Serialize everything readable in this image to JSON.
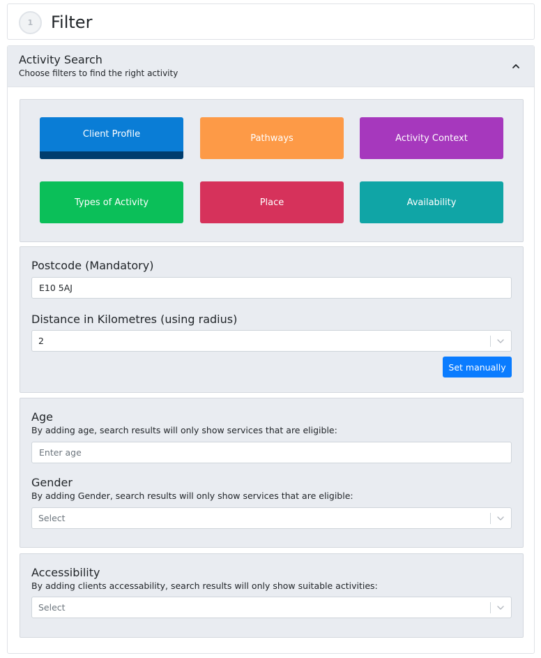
{
  "header": {
    "step_number": "1",
    "title": "Filter"
  },
  "activity_search": {
    "title": "Activity Search",
    "subtitle": "Choose filters to find the right activity",
    "toggle_icon": "chevron-up-icon"
  },
  "categories": [
    {
      "label": "Client Profile",
      "color": "#0a7dd6",
      "active": true
    },
    {
      "label": "Pathways",
      "color": "#fd9a47"
    },
    {
      "label": "Activity Context",
      "color": "#a638bd"
    },
    {
      "label": "Types of Activity",
      "color": "#0bbf59"
    },
    {
      "label": "Place",
      "color": "#d6325b"
    },
    {
      "label": "Availability",
      "color": "#10a5a6"
    }
  ],
  "location": {
    "postcode_label": "Postcode (Mandatory)",
    "postcode_value": "E10 5AJ",
    "distance_label": "Distance in Kilometres (using radius)",
    "distance_value": "2",
    "set_manually_label": "Set manually"
  },
  "age": {
    "label": "Age",
    "help": "By adding age, search results will only show services that are eligible:",
    "placeholder": "Enter age"
  },
  "gender": {
    "label": "Gender",
    "help": "By adding Gender, search results will only show services that are eligible:",
    "placeholder": "Select"
  },
  "accessibility": {
    "label": "Accessibility",
    "help": "By adding clients accessability, search results will only show suitable activities:",
    "placeholder": "Select"
  },
  "colors": {
    "primary": "#0a7cff",
    "panel_bg": "#e9ecf1"
  }
}
